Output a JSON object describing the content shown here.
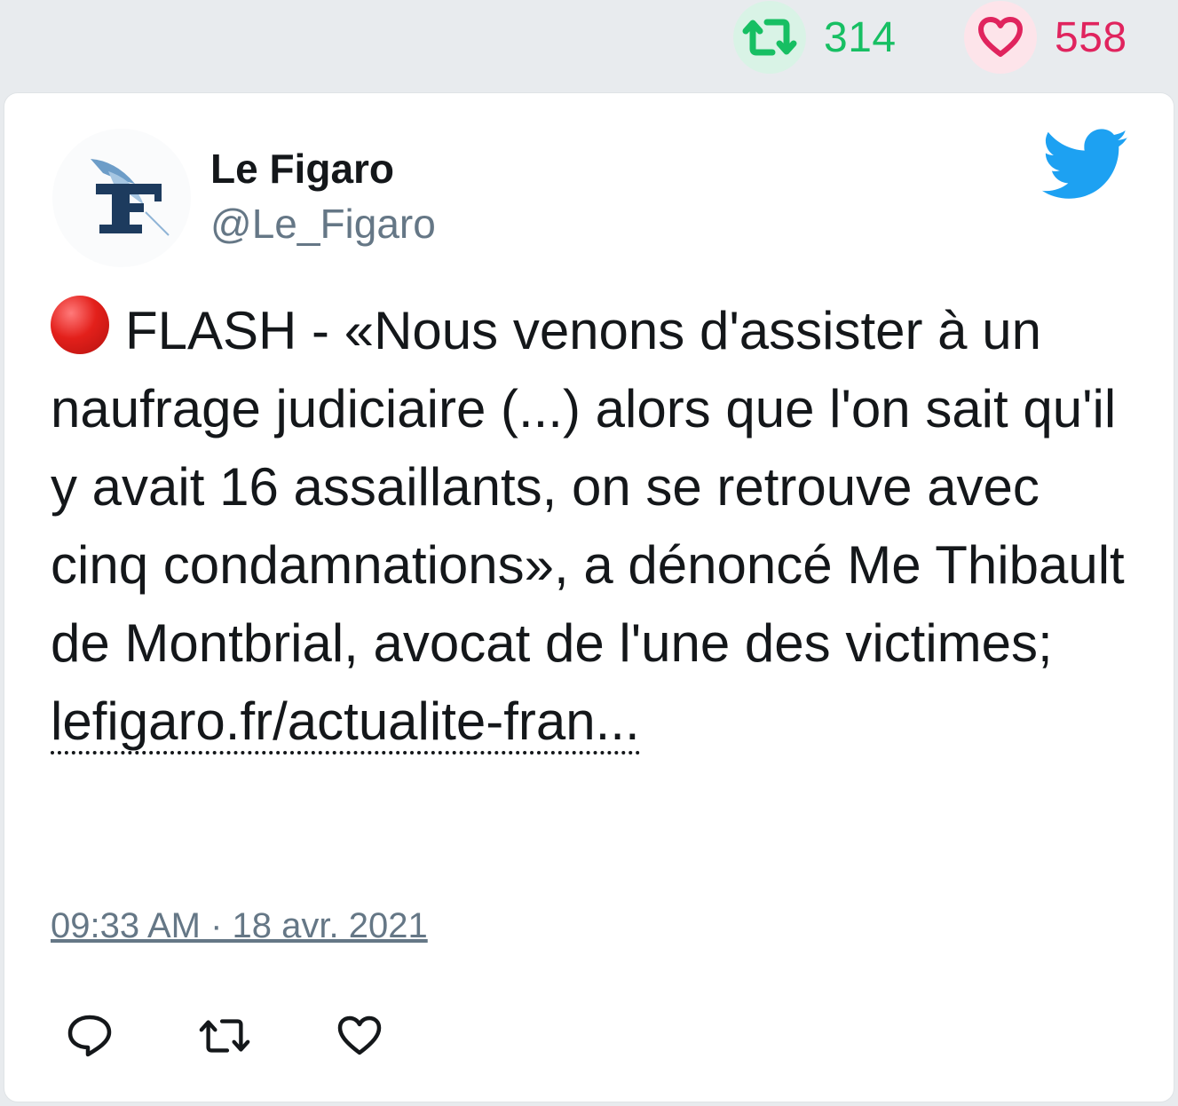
{
  "stats": {
    "retweet_count": "314",
    "like_count": "558",
    "retweet_color": "#17bf63",
    "like_color": "#e0245e"
  },
  "author": {
    "name": "Le Figaro",
    "handle": "@Le_Figaro",
    "avatar_icon": "le-figaro-logo-icon"
  },
  "brand": {
    "icon": "twitter-bird-icon",
    "color": "#1da1f2"
  },
  "tweet": {
    "emoji": "red-circle-icon",
    "text": "FLASH - «Nous venons d'assister à un naufrage judiciaire (...) alors que l'on sait qu'il y avait 16 assaillants, on se retrouve avec cinq condamnations», a dénoncé Me Thibault de Montbrial, avocat de l'une des victimes;",
    "link": "lefigaro.fr/actualite-fran...",
    "timestamp": "09:33 AM · 18 avr. 2021"
  },
  "actions": [
    {
      "name": "reply",
      "icon": "reply-icon"
    },
    {
      "name": "retweet",
      "icon": "retweet-icon"
    },
    {
      "name": "like",
      "icon": "heart-icon"
    }
  ]
}
